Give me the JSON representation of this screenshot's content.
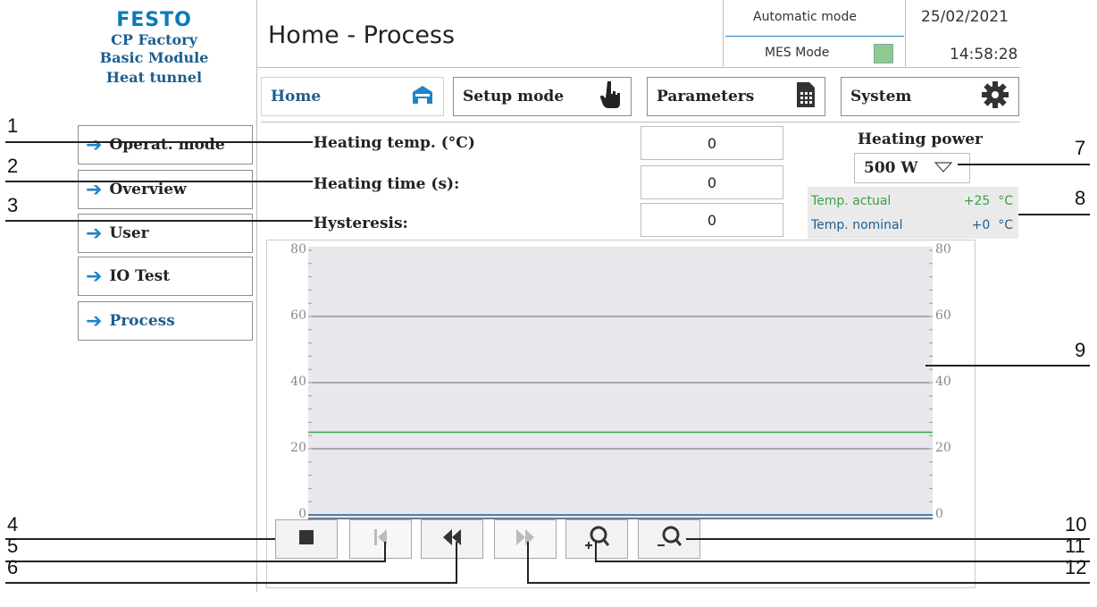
{
  "brand": {
    "logo": "FESTO",
    "line1": "CP Factory",
    "line2": "Basic Module",
    "line3": "Heat tunnel"
  },
  "header": {
    "title": "Home - Process",
    "mode": "Automatic mode",
    "mes": "MES Mode",
    "date": "25/02/2021",
    "time": "14:58:28"
  },
  "tabs": [
    {
      "label": "Home",
      "icon": "home-icon"
    },
    {
      "label": "Setup mode",
      "icon": "hand-pointer-icon"
    },
    {
      "label": "Parameters",
      "icon": "document-table-icon"
    },
    {
      "label": "System",
      "icon": "gear-icon"
    }
  ],
  "menu": [
    {
      "label": "Operat. mode"
    },
    {
      "label": "Overview"
    },
    {
      "label": "User"
    },
    {
      "label": "IO Test"
    },
    {
      "label": "Process"
    }
  ],
  "params": {
    "heating_temp_label": "Heating temp. (°C)",
    "heating_temp_value": "0",
    "heating_time_label": "Heating time (s):",
    "heating_time_value": "0",
    "hysteresis_label": "Hysteresis:",
    "hysteresis_value": "0"
  },
  "power": {
    "title": "Heating power",
    "selected": "500 W"
  },
  "legend": {
    "actual_label": "Temp. actual",
    "actual_value": "+25",
    "actual_unit": "°C",
    "actual_color": "#3aa04b",
    "nominal_label": "Temp. nominal",
    "nominal_value": "+0",
    "nominal_unit": "°C",
    "nominal_color": "#1e5e8d"
  },
  "chart_data": {
    "type": "line",
    "ylim": [
      0,
      80
    ],
    "yticks": [
      80,
      60,
      40,
      20,
      0
    ],
    "series": [
      {
        "name": "Temp. actual",
        "values": [
          25,
          25
        ],
        "color": "#3aa04b"
      },
      {
        "name": "Temp. nominal",
        "values": [
          0,
          0
        ],
        "color": "#1e5e8d"
      }
    ]
  },
  "controls": [
    {
      "icon": "stop-icon"
    },
    {
      "icon": "skip-to-start-icon"
    },
    {
      "icon": "rewind-icon"
    },
    {
      "icon": "fast-forward-icon"
    },
    {
      "icon": "zoom-in-icon"
    },
    {
      "icon": "zoom-out-icon"
    }
  ],
  "callouts": [
    "1",
    "2",
    "3",
    "4",
    "5",
    "6",
    "7",
    "8",
    "9",
    "10",
    "11",
    "12"
  ]
}
